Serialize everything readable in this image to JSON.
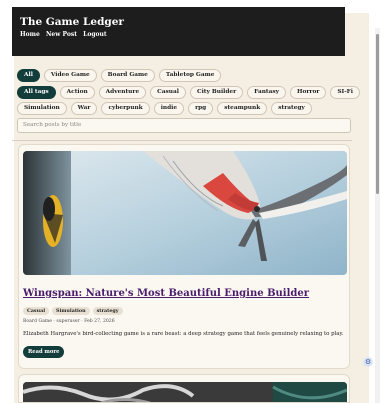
{
  "app": {
    "title": "The Game Ledger",
    "nav": [
      "Home",
      "New Post",
      "Logout"
    ]
  },
  "categories": [
    {
      "label": "All",
      "active": true
    },
    {
      "label": "Video Game",
      "active": false
    },
    {
      "label": "Board Game",
      "active": false
    },
    {
      "label": "Tabletop Game",
      "active": false
    }
  ],
  "tags_row1": [
    {
      "label": "All tags",
      "active": true
    },
    {
      "label": "Action",
      "active": false
    },
    {
      "label": "Adventure",
      "active": false
    },
    {
      "label": "Casual",
      "active": false
    },
    {
      "label": "City Builder",
      "active": false
    },
    {
      "label": "Fantasy",
      "active": false
    },
    {
      "label": "Horror",
      "active": false
    },
    {
      "label": "SI-Fi",
      "active": false
    }
  ],
  "tags_row2": [
    {
      "label": "Simulation",
      "active": false
    },
    {
      "label": "War",
      "active": false
    },
    {
      "label": "cyberpunk",
      "active": false
    },
    {
      "label": "indie",
      "active": false
    },
    {
      "label": "rpg",
      "active": false
    },
    {
      "label": "steampunk",
      "active": false
    },
    {
      "label": "strategy",
      "active": false
    }
  ],
  "search": {
    "placeholder": "Search posts by title"
  },
  "post": {
    "title": "Wingspan: Nature's Most Beautiful Engine Builder",
    "tags": [
      "Casual",
      "Simulation",
      "strategy"
    ],
    "meta": "Board Game · superuser · Feb 27, 2026",
    "excerpt": "Elizabeth Hargrave's bird-collecting game is a rare beast: a deep strategy game that feels genuinely relaxing to play.",
    "read_more": "Read more"
  },
  "colors": {
    "accent": "#123d3b",
    "title_link": "#4a1c6b",
    "header_bg": "#1d1d1d",
    "page_bg": "#f5efe3"
  },
  "icons": {
    "settings": "gear-icon"
  }
}
